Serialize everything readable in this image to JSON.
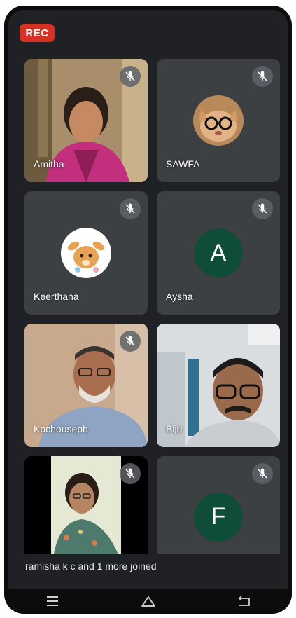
{
  "rec_label": "REC",
  "tiles": [
    {
      "name": "Amitha",
      "kind": "video",
      "muted": true
    },
    {
      "name": "SAWFA",
      "kind": "avatar-image",
      "muted": true
    },
    {
      "name": "Keerthana",
      "kind": "avatar-image",
      "muted": true
    },
    {
      "name": "Aysha",
      "kind": "avatar-letter",
      "letter": "A",
      "muted": true
    },
    {
      "name": "Kochouseph",
      "kind": "video",
      "muted": true
    },
    {
      "name": "Biju",
      "kind": "video",
      "muted": false
    },
    {
      "name": "",
      "kind": "video",
      "muted": true
    },
    {
      "name": "",
      "kind": "avatar-letter",
      "letter": "F",
      "muted": true
    }
  ],
  "toast_text": "ramisha k c and 1 more joined",
  "nav": {
    "menu_icon": "menu-icon",
    "home_icon": "home-icon",
    "back_icon": "back-icon"
  },
  "colors": {
    "rec": "#d93025",
    "tile": "#3c4043",
    "background": "#202124",
    "avatar_green": "#0f4d38"
  }
}
